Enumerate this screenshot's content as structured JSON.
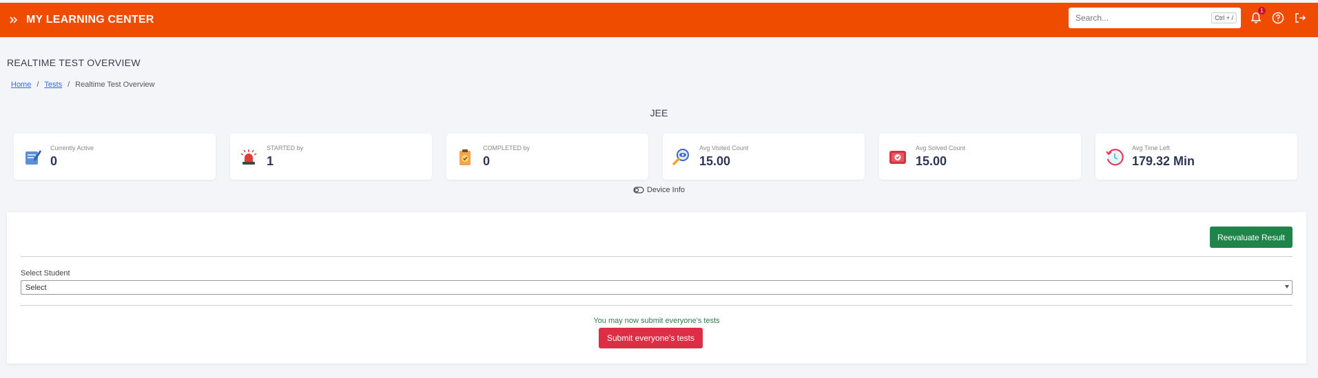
{
  "header": {
    "brand": "MY LEARNING CENTER",
    "search_placeholder": "Search...",
    "search_shortcut": "Ctrl + /",
    "notification_count": "1",
    "accent_color": "#ef4c00"
  },
  "page": {
    "title": "REALTIME TEST OVERVIEW",
    "breadcrumb": [
      "Home",
      "Tests",
      "Realtime Test Overview"
    ],
    "group_name": "JEE"
  },
  "stats": [
    {
      "label": "Currently Active",
      "value": "0",
      "icon": "tablet-pen-icon"
    },
    {
      "label": "STARTED by",
      "value": "1",
      "icon": "siren-icon"
    },
    {
      "label": "COMPLETED by",
      "value": "0",
      "icon": "clipboard-check-icon"
    },
    {
      "label": "Avg Visited Count",
      "value": "15.00",
      "icon": "magnifier-eye-icon"
    },
    {
      "label": "Avg Solved Count",
      "value": "15.00",
      "icon": "calendar-check-icon"
    },
    {
      "label": "Avg Time Left",
      "value": "179.32 Min",
      "icon": "clock-rewind-icon"
    }
  ],
  "device_info_label": "Device Info",
  "panel": {
    "reevaluate_label": "Reevaluate Result",
    "select_label": "Select Student",
    "select_value": "Select",
    "submit_note": "You may now submit everyone's tests",
    "submit_label": "Submit everyone's tests",
    "reevaluate_color": "#1e8449",
    "submit_color": "#dc2f45"
  }
}
